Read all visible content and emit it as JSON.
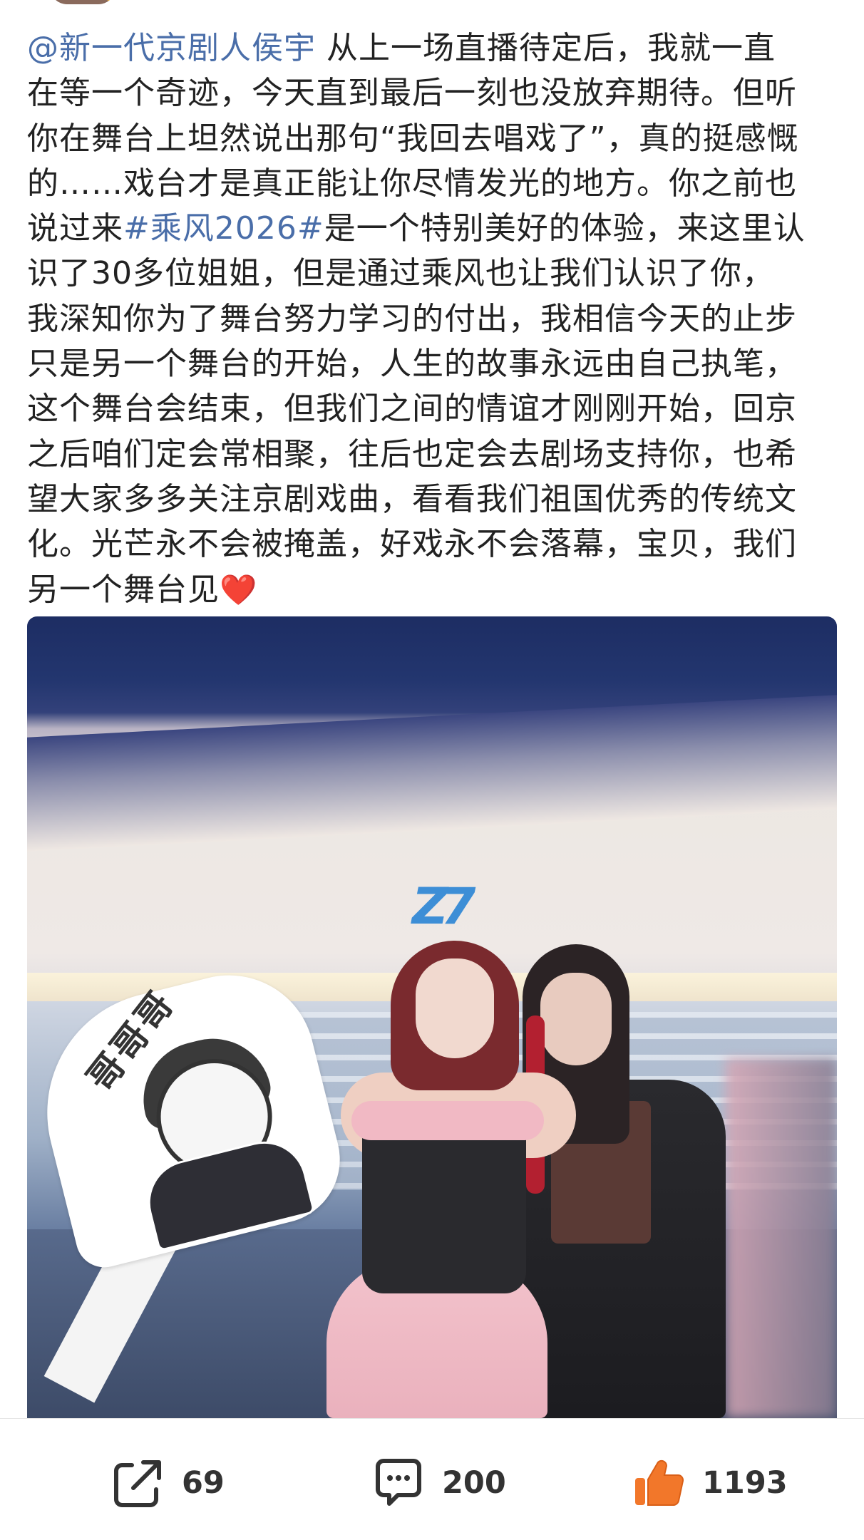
{
  "post": {
    "mention": "@新一代京剧人侯宇",
    "text_1": " 从上一场直播待定后，我就一直\n在等一个奇迹，今天直到最后一刻也没放弃期待。但听\n你在舞台上坦然说出那句“我回去唱戏了”，真的挺感慨\n的……戏台才是真正能让你尽情发光的地方。你之前也\n说过来",
    "hashtag": "#乘风2026#",
    "text_2": "是一个特别美好的体验，来这里认\n识了30多位姐姐，但是通过乘风也让我们认识了你，\n我深知你为了舞台努力学习的付出，我相信今天的止步\n只是另一个舞台的开始，人生的故事永远由自己执笔，\n这个舞台会结束，但我们之间的情谊才刚刚开始，回京\n之后咱们定会常相聚，往后也定会去剧场支持你，也希\n望大家多多关注京剧戏曲，看看我们祖国优秀的传统文\n化。光芒永不会被掩盖，好戏永不会落幕，宝贝，我们\n另一个舞台见",
    "emoji": "❤️"
  },
  "photo": {
    "sign_text": "哥哥哥"
  },
  "toolbar": {
    "repost_count": "69",
    "comment_count": "200",
    "like_count": "1193"
  },
  "colors": {
    "link": "#4a6ea9",
    "text": "#222222",
    "like_orange": "#f2772a"
  },
  "icons": {
    "repost": "share-arrow-icon",
    "comment": "comment-bubble-icon",
    "like": "thumbs-up-icon"
  }
}
